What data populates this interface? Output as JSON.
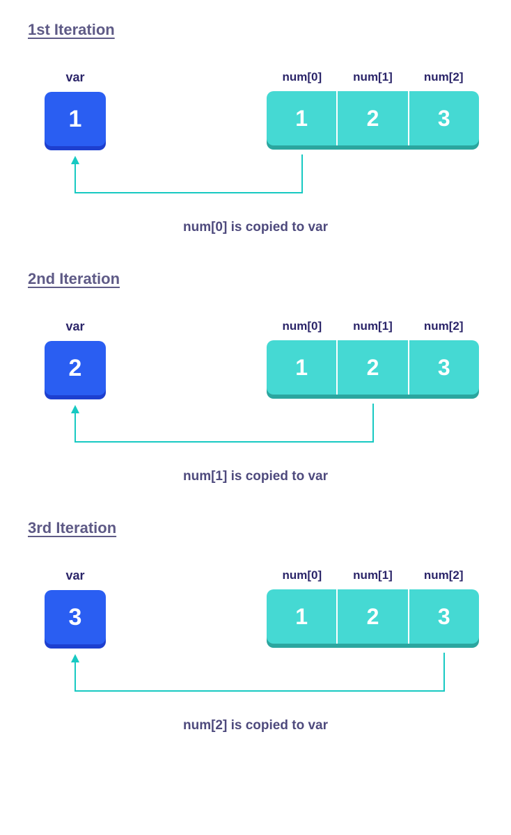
{
  "iterations": [
    {
      "title": "1st Iteration",
      "var_label": "var",
      "var_value": "1",
      "array_labels": [
        "num[0]",
        "num[1]",
        "num[2]"
      ],
      "array_values": [
        "1",
        "2",
        "3"
      ],
      "caption": "num[0] is copied to var",
      "source_index": 0
    },
    {
      "title": "2nd Iteration",
      "var_label": "var",
      "var_value": "2",
      "array_labels": [
        "num[0]",
        "num[1]",
        "num[2]"
      ],
      "array_values": [
        "1",
        "2",
        "3"
      ],
      "caption": "num[1] is copied to var",
      "source_index": 1
    },
    {
      "title": "3rd Iteration",
      "var_label": "var",
      "var_value": "3",
      "array_labels": [
        "num[0]",
        "num[1]",
        "num[2]"
      ],
      "array_values": [
        "1",
        "2",
        "3"
      ],
      "caption": "num[2] is copied to var",
      "source_index": 2
    }
  ],
  "colors": {
    "var_box": "#2a5ef2",
    "array_box": "#45d9d3",
    "connector": "#17c9c2",
    "title": "#5e5a86",
    "label": "#2b2569"
  }
}
